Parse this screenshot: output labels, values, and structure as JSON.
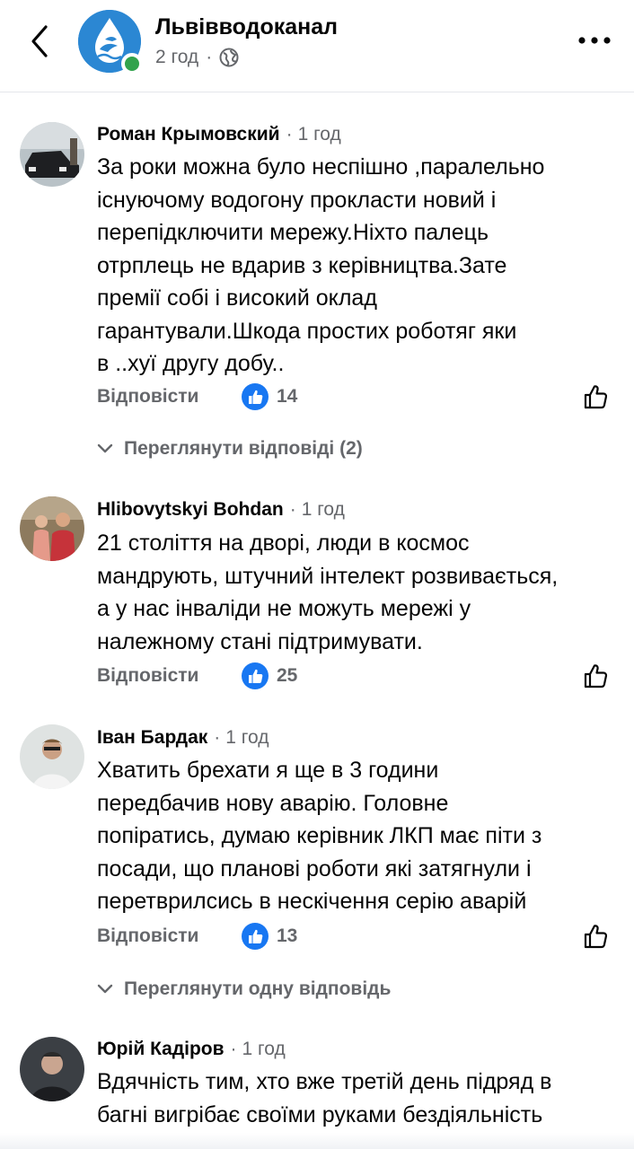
{
  "header": {
    "page_name": "Львівводоканал",
    "time": "2 год",
    "separator": "·"
  },
  "colors": {
    "accent": "#1877f2",
    "secondary_text": "#65676b",
    "online": "#31a24c"
  },
  "comments": [
    {
      "author": "Роман Крымовский",
      "time": "1 год",
      "text": "За роки можна було неспішно ,паралельно\nіснуючому водогону прокласти новий і\nперепідключити мережу.Ніхто палець\nотрплець не вдарив з керівництва.Зате\nпремії собі і високий оклад\nгарантували.Шкода простих роботяг яки\nв ..хуї другу добу..",
      "reply_label": "Відповісти",
      "likes": "14",
      "view_replies": "Переглянути відповіді (2)"
    },
    {
      "author": "Hlibovytskyi Bohdan",
      "time": "1 год",
      "text": "21 століття на дворі, люди в космос\nмандрують, штучний інтелект розвивається,\nа у нас інваліди не можуть мережі у\nналежному стані підтримувати.",
      "reply_label": "Відповісти",
      "likes": "25"
    },
    {
      "author": "Іван Бардак",
      "time": "1 год",
      "text": "Хватить брехати я ще в 3 години\nпередбачив нову аварію. Головне\nпопіратись, думаю керівник ЛКП має піти з\nпосади, що планові роботи які затягнули і\nперетврилсись в нескічення серію аварій",
      "reply_label": "Відповісти",
      "likes": "13",
      "view_replies": "Переглянути одну відповідь"
    },
    {
      "author": "Юрій Кадіров",
      "time": "1 год",
      "text": "Вдячність тим, хто вже третій день підряд в\nбагні вигрібає своїми руками бездіяльність"
    }
  ]
}
